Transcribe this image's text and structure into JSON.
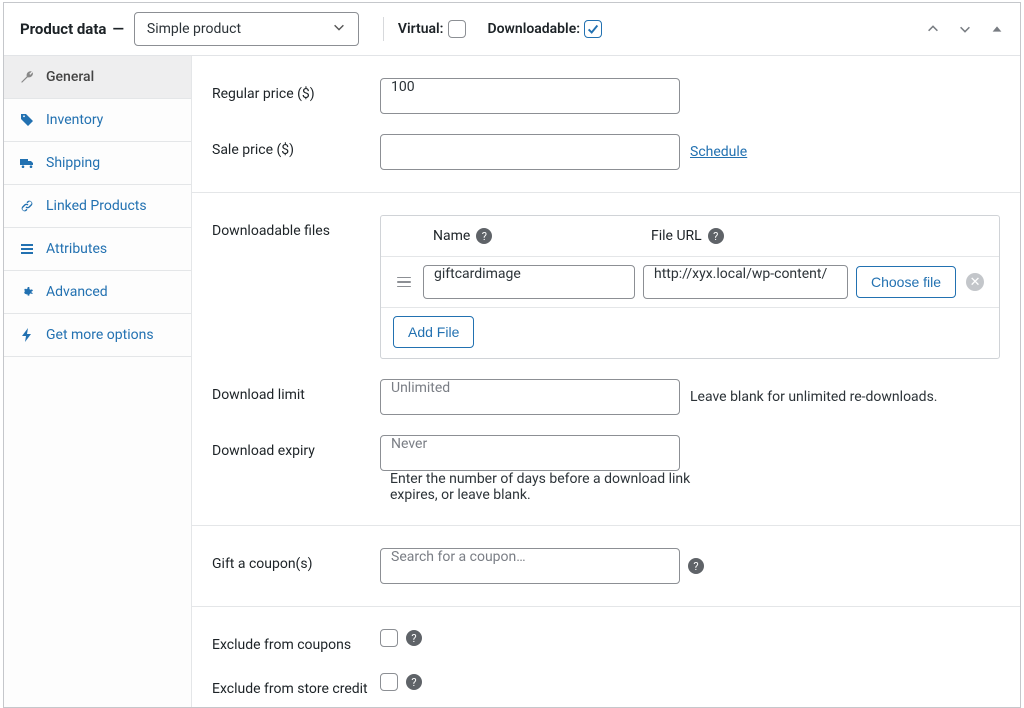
{
  "header": {
    "title": "Product data",
    "dash": "—",
    "type_value": "Simple product",
    "virtual_label": "Virtual:",
    "virtual_checked": false,
    "downloadable_label": "Downloadable:",
    "downloadable_checked": true
  },
  "tabs": [
    {
      "id": "general",
      "label": "General",
      "active": true,
      "icon": "wrench"
    },
    {
      "id": "inventory",
      "label": "Inventory",
      "active": false,
      "icon": "tag"
    },
    {
      "id": "shipping",
      "label": "Shipping",
      "active": false,
      "icon": "truck"
    },
    {
      "id": "linked",
      "label": "Linked Products",
      "active": false,
      "icon": "link"
    },
    {
      "id": "attributes",
      "label": "Attributes",
      "active": false,
      "icon": "list"
    },
    {
      "id": "advanced",
      "label": "Advanced",
      "active": false,
      "icon": "gear"
    },
    {
      "id": "more",
      "label": "Get more options",
      "active": false,
      "icon": "bolt"
    }
  ],
  "general": {
    "regular_price_label": "Regular price ($)",
    "regular_price_value": "100",
    "sale_price_label": "Sale price ($)",
    "sale_price_value": "",
    "schedule_label": "Schedule",
    "downloadable_files_label": "Downloadable files",
    "col_name": "Name",
    "col_url": "File URL",
    "files": [
      {
        "name": "giftcardimage",
        "url": "http://xyx.local/wp-content/"
      }
    ],
    "choose_file_label": "Choose file",
    "add_file_label": "Add File",
    "download_limit_label": "Download limit",
    "download_limit_placeholder": "Unlimited",
    "download_limit_help": "Leave blank for unlimited re-downloads.",
    "download_expiry_label": "Download expiry",
    "download_expiry_placeholder": "Never",
    "download_expiry_help": "Enter the number of days before a download link expires, or leave blank.",
    "gift_label": "Gift a coupon(s)",
    "gift_placeholder": "Search for a coupon…",
    "exclude_coupons_label": "Exclude from coupons",
    "exclude_store_credit_label": "Exclude from store credit"
  },
  "colors": {
    "link": "#2271b1",
    "border": "#8c8f94"
  }
}
